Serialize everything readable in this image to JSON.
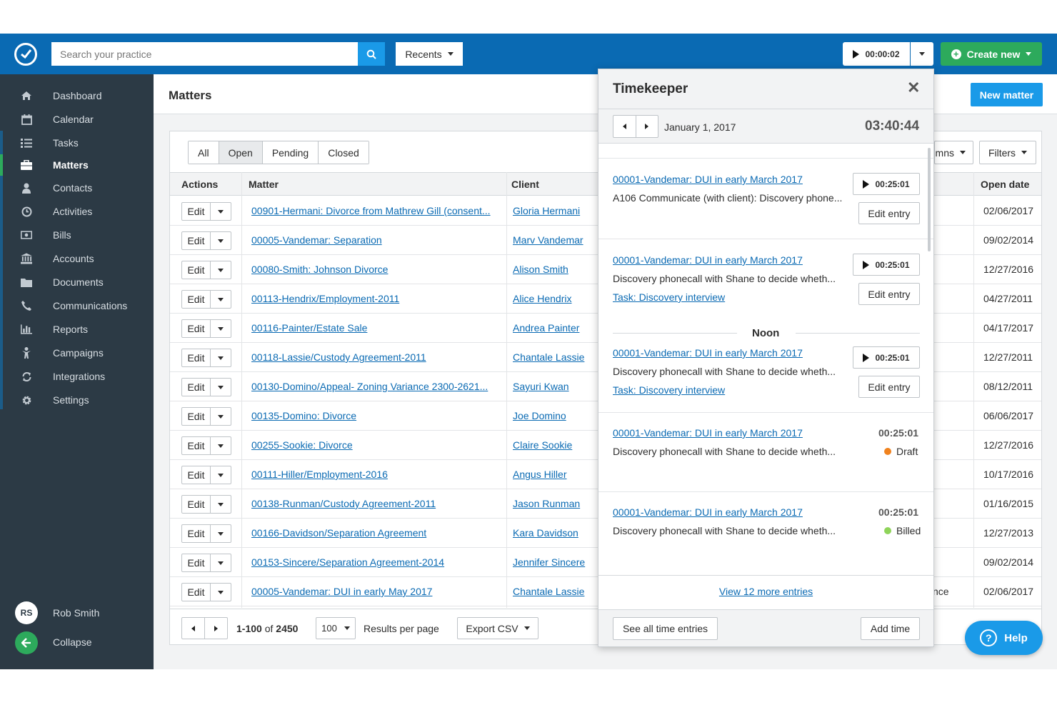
{
  "topbar": {
    "search_placeholder": "Search your practice",
    "recents_label": "Recents",
    "timer_value": "00:00:02",
    "create_label": "Create new"
  },
  "sidebar": {
    "items": [
      {
        "label": "Dashboard",
        "icon": "home-icon"
      },
      {
        "label": "Calendar",
        "icon": "calendar-icon"
      },
      {
        "label": "Tasks",
        "icon": "list-icon"
      },
      {
        "label": "Matters",
        "icon": "briefcase-icon",
        "active": true
      },
      {
        "label": "Contacts",
        "icon": "person-icon"
      },
      {
        "label": "Activities",
        "icon": "clock-icon"
      },
      {
        "label": "Bills",
        "icon": "money-icon"
      },
      {
        "label": "Accounts",
        "icon": "bank-icon"
      },
      {
        "label": "Documents",
        "icon": "folder-icon"
      },
      {
        "label": "Communications",
        "icon": "phone-icon"
      },
      {
        "label": "Reports",
        "icon": "bar-chart-icon"
      },
      {
        "label": "Campaigns",
        "icon": "campaign-icon"
      },
      {
        "label": "Integrations",
        "icon": "refresh-icon"
      },
      {
        "label": "Settings",
        "icon": "gear-icon"
      }
    ],
    "user_initials": "RS",
    "user_name": "Rob Smith",
    "collapse_label": "Collapse"
  },
  "page": {
    "title": "Matters",
    "new_matter_label": "New matter"
  },
  "matters": {
    "tabs": [
      "All",
      "Open",
      "Pending",
      "Closed"
    ],
    "selected_tab": "Open",
    "columns_button_visible_text": "mns",
    "filters_label": "Filters",
    "headers": {
      "actions": "Actions",
      "matter": "Matter",
      "client": "Client",
      "open_date": "Open date"
    },
    "edit_label": "Edit",
    "rows": [
      {
        "matter": "00901-Hermani: Divorce from Mathrew Gill (consent...",
        "client": "Gloria Hermani",
        "date": "02/06/2017"
      },
      {
        "matter": "00005-Vandemar: Separation",
        "client": "Marv Vandemar",
        "date": "09/02/2014"
      },
      {
        "matter": "00080-Smith: Johnson Divorce",
        "client": "Alison Smith",
        "date": "12/27/2016"
      },
      {
        "matter": "00113-Hendrix/Employment-2011",
        "client": "Alice Hendrix",
        "date": "04/27/2011"
      },
      {
        "matter": "00116-Painter/Estate Sale",
        "client": "Andrea Painter",
        "date": "04/17/2017"
      },
      {
        "matter": "00118-Lassie/Custody Agreement-2011",
        "client": "Chantale Lassie",
        "date": "12/27/2011"
      },
      {
        "matter": "00130-Domino/Appeal- Zoning Variance 2300-2621...",
        "client": "Sayuri Kwan",
        "date": "08/12/2011"
      },
      {
        "matter": "00135-Domino: Divorce",
        "client": "Joe Domino",
        "date": "06/06/2017"
      },
      {
        "matter": "00255-Sookie: Divorce",
        "client": "Claire Sookie",
        "date": "12/27/2016"
      },
      {
        "matter": "00111-Hiller/Employment-2016",
        "client": "Angus Hiller",
        "date": "10/17/2016"
      },
      {
        "matter": "00138-Runman/Custody Agreement-2011",
        "client": "Jason Runman",
        "date": "01/16/2015"
      },
      {
        "matter": "00166-Davidson/Separation Agreement",
        "client": "Kara Davidson",
        "date": "12/27/2013"
      },
      {
        "matter": "00153-Sincere/Separation Agreement-2014",
        "client": "Jennifer Sincere",
        "date": "09/02/2014"
      },
      {
        "matter": "00005-Vandemar: DUI in early May 2017",
        "client": "Chantale Lassie",
        "date": "02/06/2017",
        "peek": "nce"
      }
    ],
    "footer": {
      "range_bold": "1-100",
      "range_rest": " of ",
      "total": "2450",
      "per_page": "100",
      "per_page_label": "Results per page",
      "export_label": "Export CSV"
    }
  },
  "timekeeper": {
    "title": "Timekeeper",
    "date": "January 1, 2017",
    "total": "03:40:44",
    "noon_label": "Noon",
    "edit_entry_label": "Edit entry",
    "entries": [
      {
        "matter": "00001-Vandemar: DUI in early March 2017",
        "desc": "A106 Communicate (with client): Discovery phone...",
        "time": "00:25:01"
      },
      {
        "matter": "00001-Vandemar: DUI in early March 2017",
        "desc": "Discovery phonecall with Shane to decide wheth...",
        "task": "Task: Discovery interview",
        "time": "00:25:01"
      },
      {
        "matter": "00001-Vandemar: DUI in early March 2017",
        "desc": "Discovery phonecall with Shane to decide wheth...",
        "task": "Task: Discovery interview",
        "time": "00:25:01"
      },
      {
        "matter": "00001-Vandemar: DUI in early March 2017",
        "desc": "Discovery phonecall with Shane to decide wheth...",
        "duration": "00:25:01",
        "status": "Draft",
        "status_color": "#f0821e"
      },
      {
        "matter": "00001-Vandemar: DUI in early March 2017",
        "desc": "Discovery phonecall with Shane to decide wheth...",
        "duration": "00:25:01",
        "status": "Billed",
        "status_color": "#8fd45a"
      }
    ],
    "more_label": "View 12 more entries",
    "see_all_label": "See all time entries",
    "add_time_label": "Add time"
  },
  "help_label": "Help"
}
